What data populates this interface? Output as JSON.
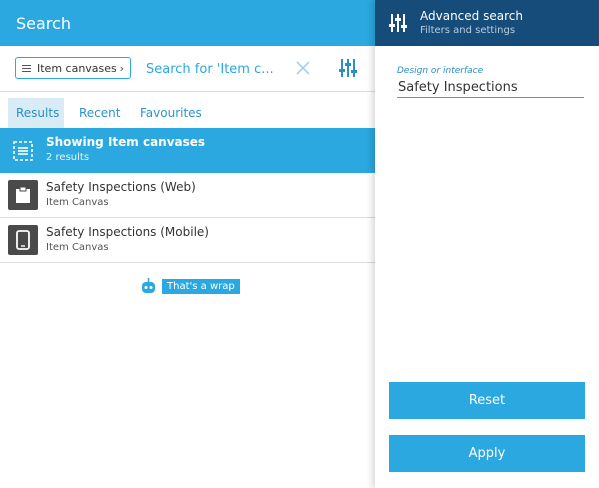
{
  "header": {
    "title": "Search"
  },
  "search": {
    "chip_label": "Item canvases",
    "placeholder": "Search for 'Item c..."
  },
  "tabs": [
    {
      "label": "Results",
      "active": true
    },
    {
      "label": "Recent",
      "active": false
    },
    {
      "label": "Favourites",
      "active": false
    }
  ],
  "summary": {
    "title": "Showing Item canvases",
    "subtitle": "2 results"
  },
  "results": [
    {
      "title": "Safety Inspections (Web)",
      "subtitle": "Item Canvas",
      "icon": "clipboard-icon"
    },
    {
      "title": "Safety Inspections (Mobile)",
      "subtitle": "Item Canvas",
      "icon": "tablet-icon"
    }
  ],
  "end_message": "That's a wrap",
  "advanced": {
    "title": "Advanced search",
    "subtitle": "Filters and settings",
    "field_label": "Design or interface",
    "field_value": "Safety Inspections",
    "reset_label": "Reset",
    "apply_label": "Apply"
  },
  "colors": {
    "accent": "#2aa8df",
    "header_dark": "#154c7a",
    "icon_bg": "#4a4a4a"
  }
}
